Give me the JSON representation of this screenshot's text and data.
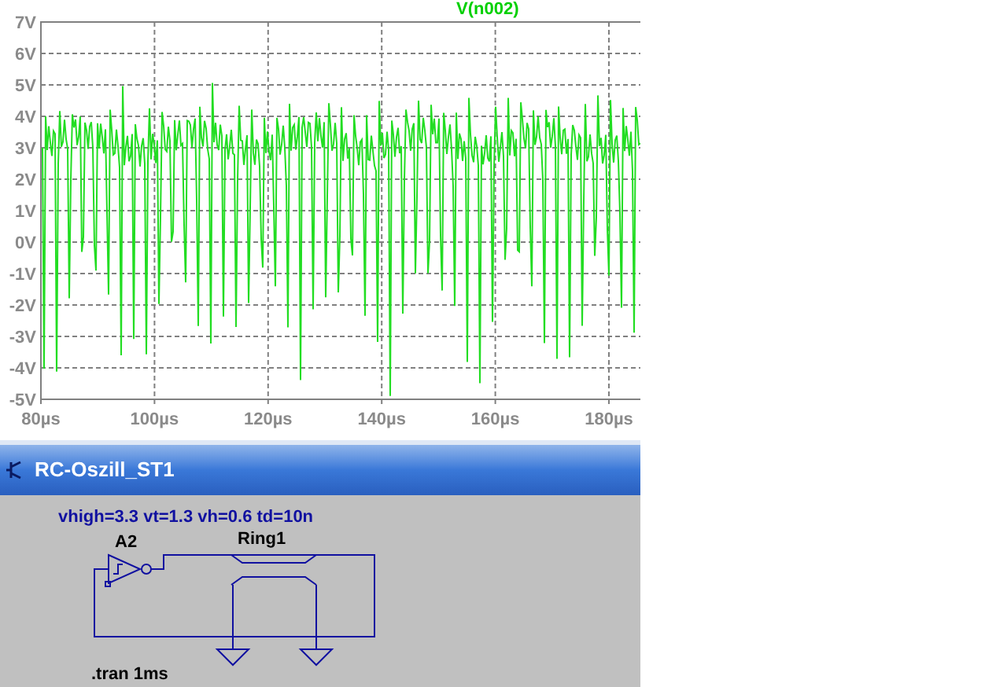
{
  "plot": {
    "trace_label": "V(n002)",
    "y_ticks": [
      "7V",
      "6V",
      "5V",
      "4V",
      "3V",
      "2V",
      "1V",
      "0V",
      "-1V",
      "-2V",
      "-3V",
      "-4V",
      "-5V"
    ],
    "x_ticks": [
      "80µs",
      "100µs",
      "120µs",
      "140µs",
      "160µs",
      "180µs"
    ]
  },
  "schematic": {
    "title": "RC-Oszill_ST1",
    "parameters": "vhigh=3.3 vt=1.3 vh=0.6 td=10n",
    "gate_label": "A2",
    "line_label": "Ring1",
    "directive": ".tran 1ms"
  }
}
